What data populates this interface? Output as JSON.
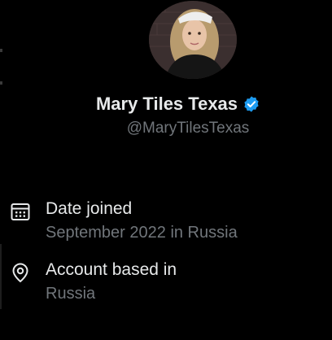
{
  "profile": {
    "display_name": "Mary Tiles Texas",
    "handle": "@MaryTilesTexas",
    "verified_icon": "verified-badge-icon",
    "avatar_icon": "profile-avatar"
  },
  "about": {
    "date_joined": {
      "title": "Date joined",
      "value": "September 2022 in Russia",
      "icon": "calendar-icon"
    },
    "account_based_in": {
      "title": "Account based in",
      "value": "Russia",
      "icon": "location-pin-icon"
    }
  },
  "colors": {
    "background": "#000000",
    "primary_text": "#e7e9ea",
    "secondary_text": "#71767b",
    "verified_blue": "#1d9bf0"
  }
}
